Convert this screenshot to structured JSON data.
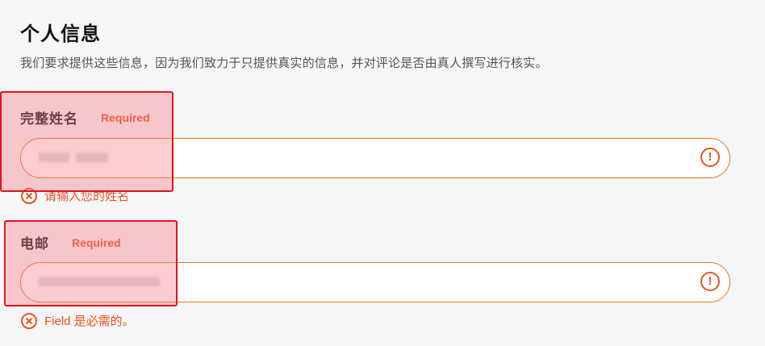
{
  "section": {
    "title": "个人信息",
    "description": "我们要求提供这些信息，因为我们致力于只提供真实的信息，并对评论是否由真人撰写进行核实。"
  },
  "fields": {
    "full_name": {
      "label": "完整姓名",
      "required_badge": "Required",
      "value": "",
      "error": "请输入您的姓名"
    },
    "email": {
      "label": "电邮",
      "required_badge": "Required",
      "value": "",
      "error": "Field 是必需的。"
    }
  },
  "icons": {
    "alert": "!",
    "error": "x-circle-icon"
  },
  "colors": {
    "accent": "#e8541c",
    "highlight_border": "#e3131f"
  }
}
